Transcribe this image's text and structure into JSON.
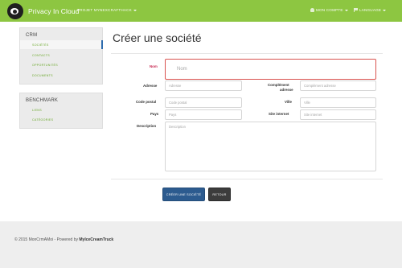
{
  "navbar": {
    "brand": "Privacy In Cloud",
    "project_menu": "PROJET MYNEXCRAFTHACK",
    "user_menu": "MON COMPTE",
    "language_menu": "LANGUAGE"
  },
  "sidebar": {
    "crm": {
      "title": "CRM",
      "items": [
        {
          "label": "SOCIÉTÉS",
          "active": true
        },
        {
          "label": "CONTACTS",
          "active": false
        },
        {
          "label": "OPPORTUNITÉS",
          "active": false
        },
        {
          "label": "DOCUMENTS",
          "active": false
        }
      ]
    },
    "benchmark": {
      "title": "BENCHMARK",
      "items": [
        {
          "label": "LIENS"
        },
        {
          "label": "CATÉGORIES"
        }
      ]
    }
  },
  "main": {
    "title": "Créer une société",
    "form": {
      "nom": {
        "label": "Nom",
        "placeholder": "Nom",
        "error": true
      },
      "adresse": {
        "label": "Adresse",
        "placeholder": "Adresse"
      },
      "complement": {
        "label_line1": "Complément",
        "label_line2": "adresse",
        "placeholder": "Complément adresse"
      },
      "code_postal": {
        "label": "Code postal",
        "placeholder": "Code postal"
      },
      "ville": {
        "label": "Ville",
        "placeholder": "Ville"
      },
      "pays": {
        "label": "Pays",
        "placeholder": "Pays"
      },
      "site_internet": {
        "label": "Site internet",
        "placeholder": "Site internet"
      },
      "description": {
        "label": "Description",
        "placeholder": "Description"
      }
    },
    "buttons": {
      "create": "CRÉER UNE SOCIÉTÉ",
      "back": "RETOUR"
    }
  },
  "footer": {
    "copyright": "© 2015 MonCrmAMoi - Powered by",
    "powered_by": "MyIceCreamTruck"
  },
  "colors": {
    "navbar": "#8dc641",
    "link": "#6aa82a",
    "primary_button": "#2c5b8f",
    "dark_button": "#3c3c3c",
    "error": "#d9534f",
    "active_indicator": "#2e6cae"
  }
}
